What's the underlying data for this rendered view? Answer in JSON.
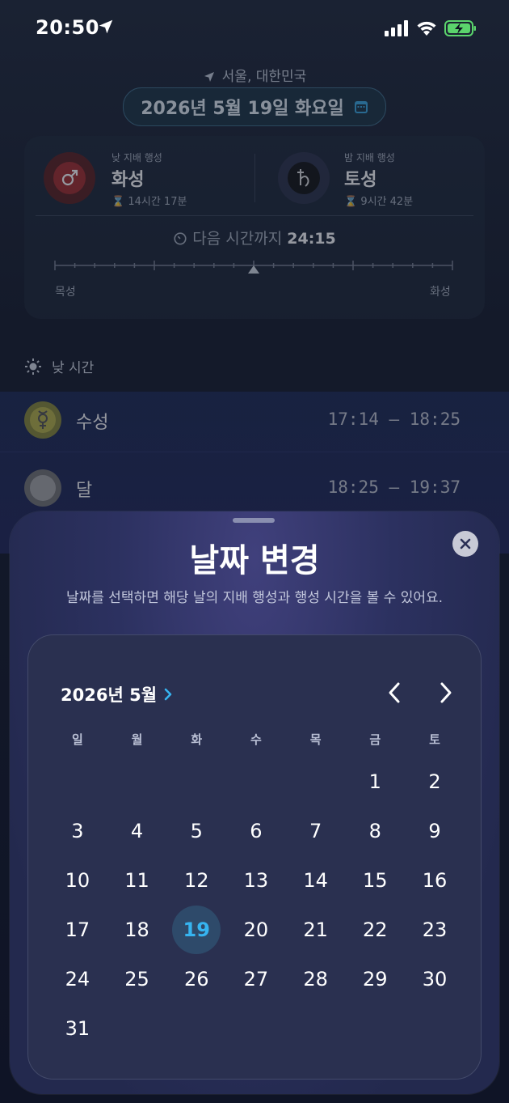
{
  "status_bar": {
    "time": "20:50"
  },
  "header": {
    "location": "서울, 대한민국",
    "date": "2026년 5월 19일 화요일"
  },
  "ruler_card": {
    "day_ruler": {
      "label": "낮 지배 행성",
      "planet": "화성",
      "duration": "14시간 17분",
      "icon": "mars-icon"
    },
    "night_ruler": {
      "label": "밤 지배 행성",
      "planet": "토성",
      "duration": "9시간 42분",
      "icon": "saturn-icon"
    },
    "next_hour_label": "다음 시간까지",
    "next_hour_value": "24:15",
    "timeline_start": "목성",
    "timeline_end": "화성"
  },
  "day_section": {
    "title": "낮 시간"
  },
  "hours": [
    {
      "planet": "수성",
      "range": "17:14 – 18:25",
      "icon": "mercury-icon"
    },
    {
      "planet": "달",
      "range": "18:25 – 19:37",
      "icon": "moon-icon"
    }
  ],
  "sheet": {
    "title": "날짜 변경",
    "subtitle": "날짜를 선택하면 해당 날의 지배 행성과 행성 시간을 볼 수 있어요.",
    "month_label": "2026년 5월",
    "weekdays": [
      "일",
      "월",
      "화",
      "수",
      "목",
      "금",
      "토"
    ],
    "leading_blanks": 5,
    "days_in_month": 31,
    "selected_day": 19
  },
  "colors": {
    "accent": "#36b4f0",
    "selected_bg": "#2e4a6a"
  }
}
